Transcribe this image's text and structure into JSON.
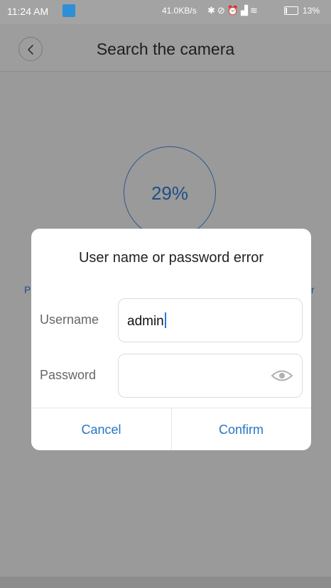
{
  "status_bar": {
    "time": "11:24 AM",
    "network_speed": "41.0KB/s",
    "icons": [
      "bluetooth-icon",
      "mute-icon",
      "alarm-icon",
      "signal-icon",
      "wifi-icon",
      "battery-icon"
    ],
    "battery_percent": "13%",
    "battery_level": 0.13
  },
  "header": {
    "title": "Search the camera",
    "back_icon": "chevron-left-icon"
  },
  "main": {
    "progress_text": "29%",
    "progress_value": 0.29,
    "left_edge_letter": "P",
    "right_edge_letter": "r"
  },
  "dialog": {
    "title": "User name or password error",
    "username_label": "Username",
    "username_value": "admin",
    "password_label": "Password",
    "password_value": "",
    "password_toggle_icon": "eye-icon",
    "cancel_label": "Cancel",
    "confirm_label": "Confirm"
  },
  "colors": {
    "accent": "#2576c4",
    "progress": "#1c4f86",
    "overlay": "#9a9a9a",
    "app_icon": "#2f8fd6"
  }
}
